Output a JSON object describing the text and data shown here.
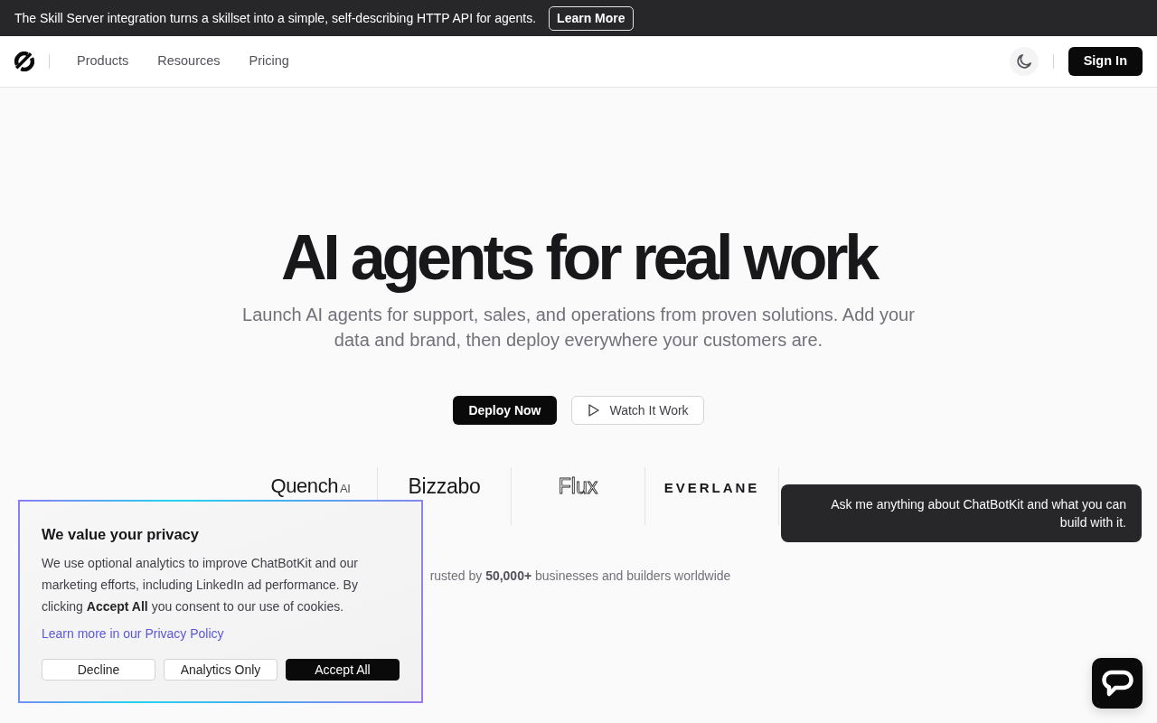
{
  "announcement": {
    "text": "The Skill Server integration turns a skillset into a simple, self-describing HTTP API for agents.",
    "button": "Learn More"
  },
  "navbar": {
    "links": [
      "Products",
      "Resources",
      "Pricing"
    ],
    "sign_in": "Sign In"
  },
  "hero": {
    "title": "AI agents for real work",
    "subtitle": "Launch AI agents for support, sales, and operations from proven solutions. Add your data and brand, then deploy everywhere your customers are.",
    "buttons": [
      {
        "label": "Deploy Now",
        "kind": "primary"
      },
      {
        "label": "Watch It Work",
        "kind": "play"
      }
    ]
  },
  "logos": [
    {
      "kind": "light",
      "name": "Quench",
      "tag": "AI"
    },
    {
      "kind": "medium",
      "name": "Bizzabo"
    },
    {
      "kind": "outline",
      "name": "Flux"
    },
    {
      "kind": "spaced",
      "name": "EVERLANE"
    }
  ],
  "trusted": "rusted by **50,000+** businesses and builders worldwide",
  "cookie_banner": {
    "title": "We value your privacy",
    "text": "We use optional analytics to improve ChatBotKit and our marketing efforts, including LinkedIn ad performance. By clicking **Accept All** you consent to our use of cookies.",
    "link": "Learn more in our Privacy Policy",
    "buttons": [
      {
        "label": "Decline",
        "kind": "outline"
      },
      {
        "label": "Analytics Only",
        "kind": "outline"
      },
      {
        "label": "Accept All",
        "kind": "primary"
      }
    ]
  },
  "chat": {
    "greeting": "Ask me anything about ChatBotKit and what you can build with it."
  }
}
